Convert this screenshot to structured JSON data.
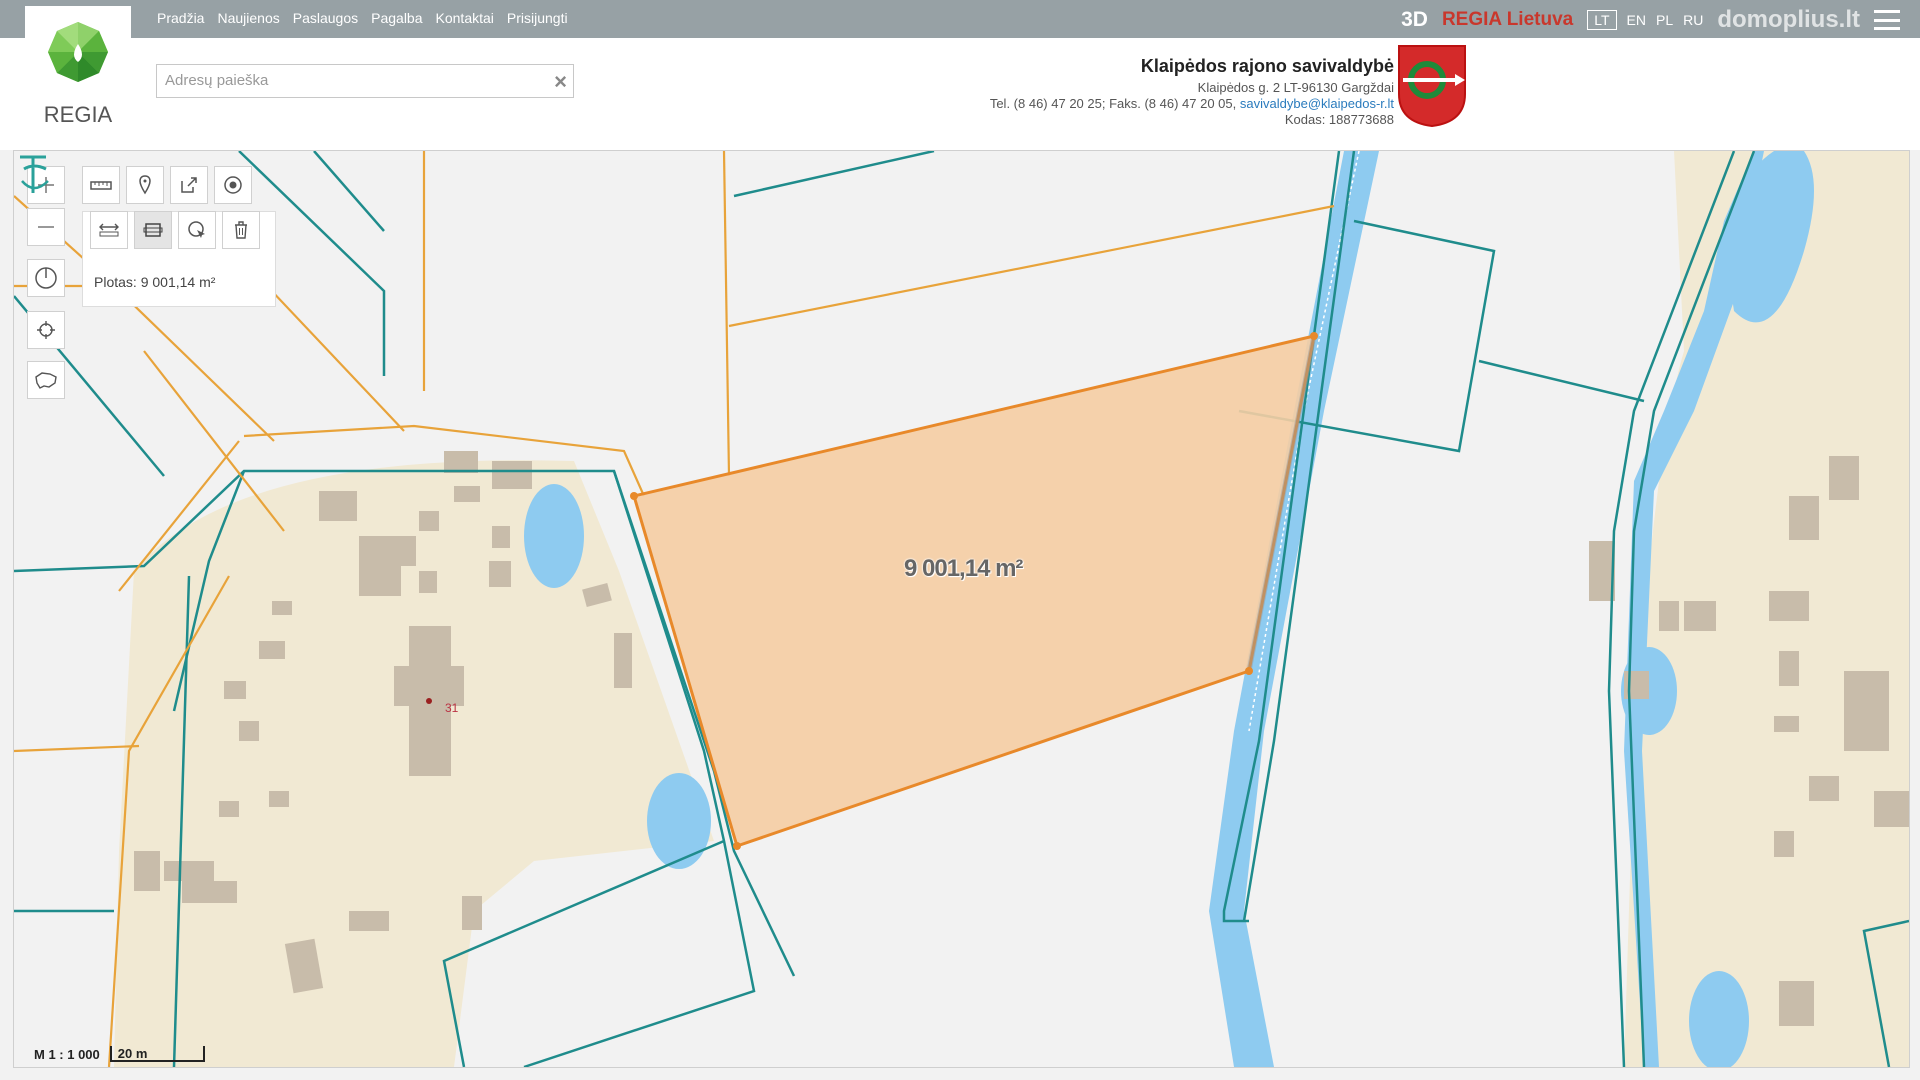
{
  "nav": {
    "items": [
      "Pradžia",
      "Naujienos",
      "Paslaugos",
      "Pagalba",
      "Kontaktai",
      "Prisijungti"
    ]
  },
  "logo": {
    "text": "REGIA"
  },
  "top_right": {
    "btn_3d": "3D",
    "regia_lt": "REGIA Lietuva",
    "langs": [
      "LT",
      "EN",
      "PL",
      "RU"
    ],
    "active_lang": "LT",
    "watermark": "domoplius.lt"
  },
  "search": {
    "placeholder": "Adresų paieška"
  },
  "org": {
    "name": "Klaipėdos rajono savivaldybė",
    "address": "Klaipėdos g. 2 LT-96130 Gargždai",
    "phone": "Tel. (8 46) 47 20 25; Faks. (8 46) 47 20 05,",
    "email": "savivaldybe@klaipedos-r.lt",
    "code": "Kodas: 188773688"
  },
  "measure": {
    "panel_text": "Plotas: 9 001,14 m²",
    "area_label": "9 001,14 m²",
    "parcel_number": "31"
  },
  "scale": {
    "ratio": "M 1 : 1 000",
    "bar": "20 m"
  },
  "colors": {
    "parcel_orange": "#e8892a",
    "cadastre_teal": "#1f8c8c",
    "water_blue": "#8ecbf0",
    "building": "#c8bcaa",
    "yard": "#f1e9d3"
  },
  "icons": [
    "plus-icon",
    "minus-icon",
    "ruler-icon",
    "pin-icon",
    "share-icon",
    "target-icon",
    "measure-line-icon",
    "measure-area-icon",
    "pointer-icon",
    "trash-icon",
    "compass-icon",
    "locate-icon",
    "lithuania-icon"
  ]
}
